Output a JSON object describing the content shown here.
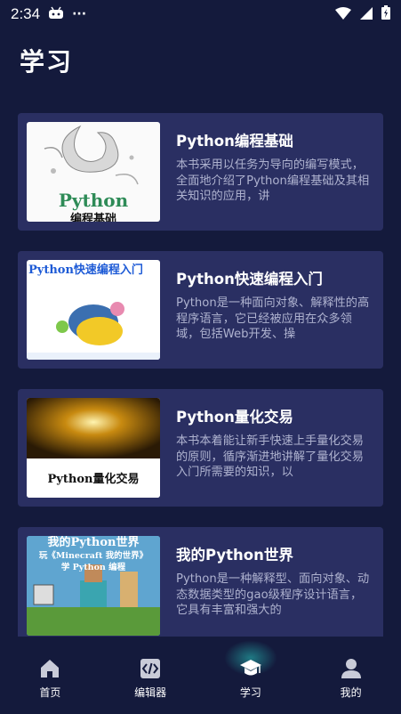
{
  "status_bar": {
    "time": "2:34",
    "more": "···"
  },
  "page": {
    "title": "学习"
  },
  "books": [
    {
      "title": "Python编程基础",
      "description": "本书采用以任务为导向的编写模式，全面地介绍了Python编程基础及其相关知识的应用，讲",
      "cover_text": [
        "Python",
        "编程基础"
      ]
    },
    {
      "title": "Python快速编程入门",
      "description": "Python是一种面向对象、解释性的高程序语言，它已经被应用在众多领域，包括Web开发、操",
      "cover_text": [
        "Python快速编程入门"
      ]
    },
    {
      "title": "Python量化交易",
      "description": "本书本着能让新手快速上手量化交易的原则，循序渐进地讲解了量化交易入门所需要的知识，以",
      "cover_text": [
        "Python量化交易"
      ]
    },
    {
      "title": "我的Python世界",
      "description": "Python是一种解释型、面向对象、动态数据类型的gao级程序设计语言，它具有丰富和强大的",
      "cover_text": [
        "我的Python世界",
        "玩《Minecraft 我的世界》",
        "学 Python 编程"
      ]
    }
  ],
  "tabs": [
    {
      "label": "首页",
      "icon": "home-icon"
    },
    {
      "label": "编辑器",
      "icon": "code-icon"
    },
    {
      "label": "学习",
      "icon": "graduation-cap-icon",
      "active": true
    },
    {
      "label": "我的",
      "icon": "user-icon"
    }
  ],
  "colors": {
    "background": "#141a3c",
    "card": "#2a2f62",
    "accent": "#2ec9bd"
  }
}
